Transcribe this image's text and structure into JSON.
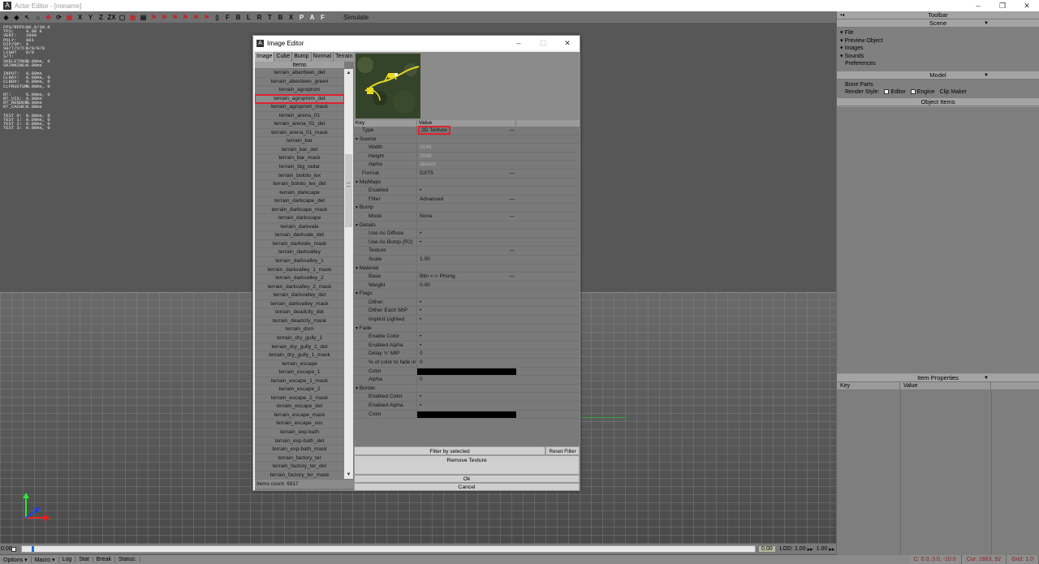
{
  "window": {
    "title": "Actor Editor - [noname]",
    "app_icon_glyph": "A",
    "controls": [
      "–",
      "❐",
      "✕"
    ]
  },
  "toolbar": {
    "buttons": [
      {
        "glyph": "◆",
        "icon": "arrow-left-icon"
      },
      {
        "glyph": "◆",
        "icon": "arrow-right-icon"
      },
      {
        "glyph": "↖",
        "icon": "select-icon"
      },
      {
        "glyph": "⌂",
        "icon": "camera-icon"
      },
      {
        "glyph": "✥",
        "icon": "move-icon",
        "red": true
      },
      {
        "glyph": "⟳",
        "icon": "rotate-icon"
      },
      {
        "glyph": "▣",
        "icon": "scale-icon",
        "red": true
      },
      {
        "glyph": "X",
        "icon": "axis-x-icon"
      },
      {
        "glyph": "Y",
        "icon": "axis-y-icon"
      },
      {
        "glyph": "Z",
        "icon": "axis-z-icon"
      },
      {
        "glyph": "ZX",
        "icon": "axis-zx-icon"
      },
      {
        "glyph": "▢",
        "icon": "grid-snap-icon"
      },
      {
        "glyph": "▣",
        "icon": "object-snap-icon",
        "red": true
      },
      {
        "glyph": "▤",
        "icon": "box-icon"
      },
      {
        "glyph": "⚑",
        "icon": "snap-1-icon",
        "red": true
      },
      {
        "glyph": "⚑",
        "icon": "snap-2-icon",
        "red": true
      },
      {
        "glyph": "⚑",
        "icon": "snap-3-icon",
        "red": true
      },
      {
        "glyph": "⚑",
        "icon": "snap-4-icon",
        "red": true
      },
      {
        "glyph": "⚑",
        "icon": "snap-5-icon",
        "red": true
      },
      {
        "glyph": "⚑",
        "icon": "snap-6-icon",
        "red": true
      },
      {
        "glyph": "▯",
        "icon": "view-icon"
      },
      {
        "glyph": "F",
        "icon": "view-front-icon"
      },
      {
        "glyph": "B",
        "icon": "view-back-icon"
      },
      {
        "glyph": "L",
        "icon": "view-left-icon"
      },
      {
        "glyph": "R",
        "icon": "view-right-icon"
      },
      {
        "glyph": "T",
        "icon": "view-top-icon"
      },
      {
        "glyph": "B",
        "icon": "view-bottom-icon"
      },
      {
        "glyph": "X",
        "icon": "view-reset-icon"
      },
      {
        "glyph": "P",
        "icon": "perspective-icon",
        "white": true
      },
      {
        "glyph": "A",
        "icon": "orbit-icon",
        "white": true
      },
      {
        "glyph": "F",
        "icon": "fly-icon",
        "white": true
      }
    ],
    "simulate_label": "Simulate"
  },
  "stats": [
    [
      "FPS/RFPS:",
      "80.8/30.0"
    ],
    [
      "TPS:",
      "0.00 K"
    ],
    [
      "VERT:",
      "2880"
    ],
    [
      "POLY:",
      "881"
    ],
    [
      "DIP/DP:",
      "8"
    ],
    [
      "SH/T/V/C:",
      "0/0/0/0"
    ],
    [
      "LIGHT S/T:",
      "0/0"
    ],
    [
      "SKELETONS:",
      "0.00ms, 0"
    ],
    [
      "SKINNING:",
      "0.00ms"
    ],
    null,
    [
      "INPUT:",
      "0.00ms"
    ],
    [
      "CLRAY:",
      "0.00ms, 0"
    ],
    [
      "CLBOX:",
      "0.00ms, 0"
    ],
    [
      "CLFRUSTUM:",
      "0.00ms, 0"
    ],
    null,
    [
      "RT:",
      "0.00ms, 0"
    ],
    [
      "RT_VIS:",
      "0.00ms"
    ],
    [
      "RT_RENDER:",
      "0.00ms"
    ],
    [
      "RT_CACHE:",
      "0.00ms"
    ],
    null,
    [
      "TEST 0:",
      "0.00ms, 0"
    ],
    [
      "TEST 1:",
      "0.00ms, 0"
    ],
    [
      "TEST 2:",
      "0.00ms, 0"
    ],
    [
      "TEST 3:",
      "0.00ms, 0"
    ]
  ],
  "right_panel": {
    "toolbar_header": "Toolbar",
    "scene_header": "Scene",
    "scene_items": [
      {
        "label": "File",
        "arrow": "▾"
      },
      {
        "label": "Preview Object",
        "arrow": "▾"
      },
      {
        "label": "Images",
        "arrow": "▾"
      },
      {
        "label": "Sounds",
        "arrow": "▾"
      },
      {
        "label": "Preferences",
        "arrow": ""
      }
    ],
    "model_header": "Model",
    "bone_parts": "Bone Parts",
    "render_style_label": "Render Style:",
    "render_editor": "Editor",
    "render_engine": "Engine",
    "clip_maker": "Clip Maker",
    "object_items_header": "Object Items",
    "item_properties_header": "Item Properties",
    "key_col": "Key",
    "value_col": "Value"
  },
  "dialog": {
    "title": "Image Editor",
    "tabs": [
      "Image",
      "Cube",
      "Bump",
      "Normal",
      "Terrain"
    ],
    "items_header": "Items",
    "items": [
      "terrain_aberdeen_det",
      "terrain_aberdeen_green",
      "terrain_agroprom",
      "terrain_agroprom_det",
      "terrain_agroprom_mask",
      "terrain_arena_01",
      "terrain_arena_01_det",
      "terrain_arena_01_mask",
      "terrain_bar",
      "terrain_bar_det",
      "terrain_bar_mask",
      "terrain_big_radar",
      "terrain_boloto_lex",
      "terrain_boloto_lex_det",
      "terrain_darkcape",
      "terrain_darkcape_det",
      "terrain_darkcape_mask",
      "terrain_darkscape",
      "terrain_darkvale",
      "terrain_darkvale_det",
      "terrain_darkvale_mask",
      "terrain_darkvalley",
      "terrain_darkvalley_1",
      "terrain_darkvalley_1_mask",
      "terrain_darkvalley_2",
      "terrain_darkvalley_2_mask",
      "terrain_darkvalley_det",
      "terrain_darkvalley_mask",
      "terrain_deadcity_det",
      "terrain_deadcity_mask",
      "terrain_dom",
      "terrain_dry_gully_1",
      "terrain_dry_gully_1_det",
      "terrain_dry_gully_1_mask",
      "terrain_escape",
      "terrain_escape_1",
      "terrain_escape_1_mask",
      "terrain_escape_2",
      "terrain_escape_2_mask",
      "terrain_escape_det",
      "terrain_escape_mask",
      "terrain_escape_soc",
      "terrain_exp-bath",
      "terrain_exp-bath_det",
      "terrain_exp-bath_mask",
      "terrain_factory_ter",
      "terrain_factory_ter_det",
      "terrain_factory_ter_mask"
    ],
    "selected_index": 3,
    "items_count": "Items count: 6917",
    "props_key": "Key",
    "props_value": "Value",
    "properties": [
      {
        "k": "Type",
        "v": "2D Texture",
        "style": "plain",
        "hl": true,
        "dash": true
      },
      {
        "k": "Source",
        "v": "",
        "style": "group"
      },
      {
        "k": "Width",
        "v": "2048",
        "style": "child",
        "dim": true
      },
      {
        "k": "Height",
        "v": "2048",
        "style": "child",
        "dim": true
      },
      {
        "k": "Alpha",
        "v": "absent",
        "style": "child",
        "dim": true
      },
      {
        "k": "Format",
        "v": "DXT5",
        "style": "plain",
        "dash": true
      },
      {
        "k": "MipMaps",
        "v": "",
        "style": "group"
      },
      {
        "k": "Enabled",
        "v": "•",
        "style": "child"
      },
      {
        "k": "Filter",
        "v": "Advanced",
        "style": "child",
        "dash": true
      },
      {
        "k": "Bump",
        "v": "",
        "style": "group"
      },
      {
        "k": "Mode",
        "v": "None",
        "style": "child",
        "dash": true
      },
      {
        "k": "Details",
        "v": "",
        "style": "group"
      },
      {
        "k": "Use As Diffuse",
        "v": "•",
        "style": "child"
      },
      {
        "k": "Use As Bump (R2)",
        "v": "•",
        "style": "child"
      },
      {
        "k": "Texture",
        "v": "",
        "style": "child",
        "dash": true
      },
      {
        "k": "Scale",
        "v": "1.00",
        "style": "child"
      },
      {
        "k": "Material",
        "v": "",
        "style": "group"
      },
      {
        "k": "Base",
        "v": "Blin <-> Phong",
        "style": "child",
        "dash": true
      },
      {
        "k": "Weight",
        "v": "0.00",
        "style": "child"
      },
      {
        "k": "Flags",
        "v": "",
        "style": "group"
      },
      {
        "k": "Dither",
        "v": "•",
        "style": "child"
      },
      {
        "k": "Dither Each MIP",
        "v": "•",
        "style": "child"
      },
      {
        "k": "Implicit Lighted",
        "v": "•",
        "style": "child"
      },
      {
        "k": "Fade",
        "v": "",
        "style": "group"
      },
      {
        "k": "Enable Color",
        "v": "•",
        "style": "child"
      },
      {
        "k": "Enabled Alpha",
        "v": "•",
        "style": "child"
      },
      {
        "k": "Delay 'n' MIP",
        "v": "0",
        "style": "child"
      },
      {
        "k": "% of color to fade in",
        "v": "0",
        "style": "child"
      },
      {
        "k": "Color",
        "v": "",
        "style": "child",
        "swatch": "#000000"
      },
      {
        "k": "Alpha",
        "v": "0",
        "style": "child"
      },
      {
        "k": "Border",
        "v": "",
        "style": "group"
      },
      {
        "k": "Enabled Color",
        "v": "•",
        "style": "child"
      },
      {
        "k": "Enabled Alpha",
        "v": "•",
        "style": "child"
      },
      {
        "k": "Color",
        "v": "",
        "style": "child",
        "swatch": "#000000"
      }
    ],
    "filter_by_selected": "Filter by selected",
    "reset_filter": "Reset Filter",
    "remove_texture": "Remove Texture",
    "ok": "Ok",
    "cancel": "Cancel"
  },
  "timeline": {
    "start_value": "0.00",
    "end_value": "0.00",
    "lod_label": "LOD:",
    "lod_value": "1.00",
    "lod_value2": "1.00"
  },
  "statusbar": {
    "options": "Options",
    "macro": "Macro",
    "log": "Log",
    "stat": "Stat",
    "break": "Break",
    "status": "Status:",
    "coords": "C: 0.0, 3.0, -10.0",
    "cur": "Cur: 1663, 92",
    "grid": "Grid: 1.0"
  },
  "colors": {
    "highlight": "#e0222c",
    "viewport": "#575757",
    "panel": "#808080"
  }
}
